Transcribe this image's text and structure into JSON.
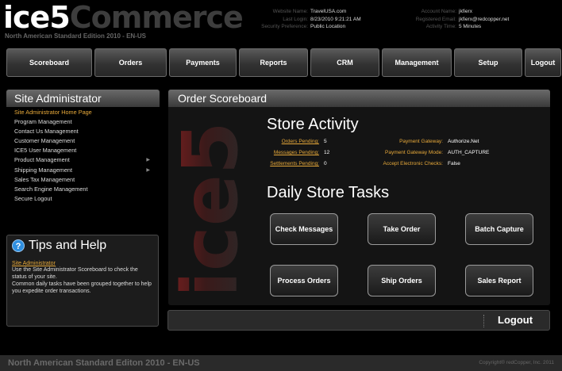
{
  "header": {
    "logo_ice": "ice5",
    "logo_commerce": "Commerce",
    "logo_sub": "North American Standard Edition 2010 - EN-US",
    "site_info": [
      {
        "label": "Website Name:",
        "value": "TravelUSA.com"
      },
      {
        "label": "Last Login:",
        "value": "8/23/2010 9:21:21 AM"
      },
      {
        "label": "Security Preference:",
        "value": "Public Location"
      }
    ],
    "account_info": [
      {
        "label": "Account Name:",
        "value": "jkfierx"
      },
      {
        "label": "Registered Email:",
        "value": "jkfierx@redcopper.net"
      },
      {
        "label": "Activity Time:",
        "value": "5 Minutes"
      }
    ]
  },
  "nav": {
    "items": [
      "Scoreboard",
      "Orders",
      "Payments",
      "Reports",
      "CRM",
      "Management",
      "Setup",
      "Logout"
    ]
  },
  "sidebar": {
    "title": "Site Administrator",
    "items": [
      "Site Administrator Home Page",
      "Program Management",
      "Contact Us Management",
      "Customer Management",
      "ICE5 User Management",
      "Product Management",
      "Shipping Management",
      "Sales Tax Management",
      "Search Engine Management",
      "Secure Logout"
    ]
  },
  "tips": {
    "title": "Tips and Help",
    "link": "Site Administrator",
    "paragraphs": [
      "Use the Site Administrator Scoreboard to check the status of your site.",
      "Common daily tasks have been grouped together to help you expedite order transactions."
    ]
  },
  "main": {
    "title": "Order Scoreboard",
    "watermark": "ice5",
    "store_activity": {
      "title": "Store Activity",
      "orders_pending_label": "Orders Pending:",
      "orders_pending": "5",
      "messages_pending_label": "Messages Pending:",
      "messages_pending": "12",
      "settlements_pending_label": "Settlements Pending:",
      "settlements_pending": "0",
      "gateway_label": "Payment Gateway:",
      "gateway": "Authorize.Net",
      "gateway_mode_label": "Payment Gateway Mode:",
      "gateway_mode": "AUTH_CAPTURE",
      "echecks_label": "Accept Electronic Checks:",
      "echecks": "False"
    },
    "tasks": {
      "title": "Daily Store Tasks",
      "buttons": [
        "Check Messages",
        "Take Order",
        "Batch Capture",
        "Process Orders",
        "Ship Orders",
        "Sales Report"
      ]
    }
  },
  "logout_bar": {
    "label": "Logout"
  },
  "footer": {
    "left": "North American Standard Editon 2010 - EN-US",
    "right": "Copyright® redCopper, Inc. 2011"
  },
  "colors": {
    "accent_orange": "#e7a93a",
    "help_blue": "#2f8fe0",
    "watermark_red": "#7a1f1f"
  }
}
